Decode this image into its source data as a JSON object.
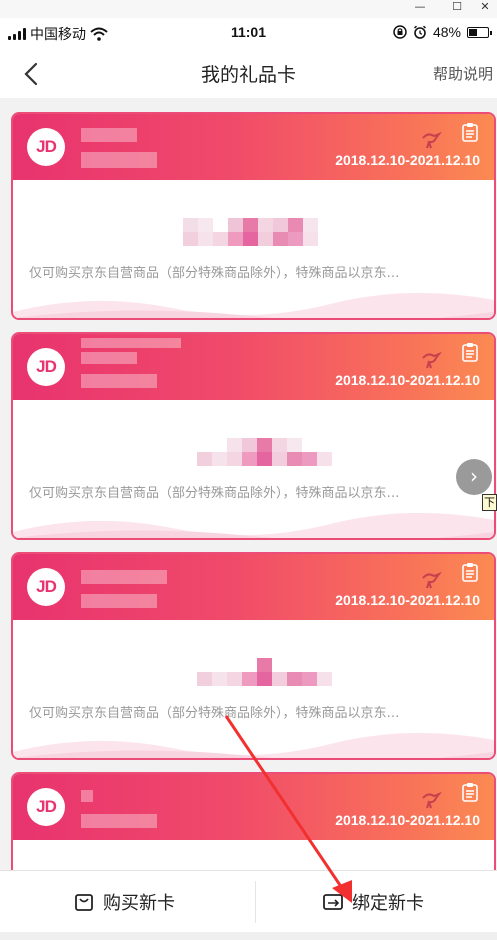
{
  "window": {
    "minimize": "—",
    "restore": "☐",
    "close": "✕"
  },
  "status_bar": {
    "carrier": "中国移动",
    "time": "11:01",
    "battery_percent": "48%",
    "battery_level": 0.48,
    "icons": [
      "signal-icon",
      "wifi-icon",
      "rotation-lock-icon",
      "alarm-icon",
      "battery-icon"
    ]
  },
  "nav": {
    "title": "我的礼品卡",
    "help": "帮助说明",
    "back_icon": "chevron-left-icon"
  },
  "cards": [
    {
      "logo": "JD",
      "date": "2018.12.10-2021.12.10",
      "desc": "仅可购买京东自营商品（部分特殊商品除外），特殊商品以京东…"
    },
    {
      "logo": "JD",
      "date": "2018.12.10-2021.12.10",
      "desc": "仅可购买京东自营商品（部分特殊商品除外），特殊商品以京东…"
    },
    {
      "logo": "JD",
      "date": "2018.12.10-2021.12.10",
      "desc": "仅可购买京东自营商品（部分特殊商品除外），特殊商品以京东…"
    },
    {
      "logo": "JD",
      "date": "2018.12.10-2021.12.10",
      "desc": ""
    }
  ],
  "floating": {
    "scroll_glyph": "›",
    "tag": "下"
  },
  "bottom": {
    "buy_label": "购买新卡",
    "bind_label": "绑定新卡"
  },
  "colors": {
    "accent": "#e8336f",
    "gradient_end": "#fb8a52",
    "annotation": "#f23030"
  }
}
